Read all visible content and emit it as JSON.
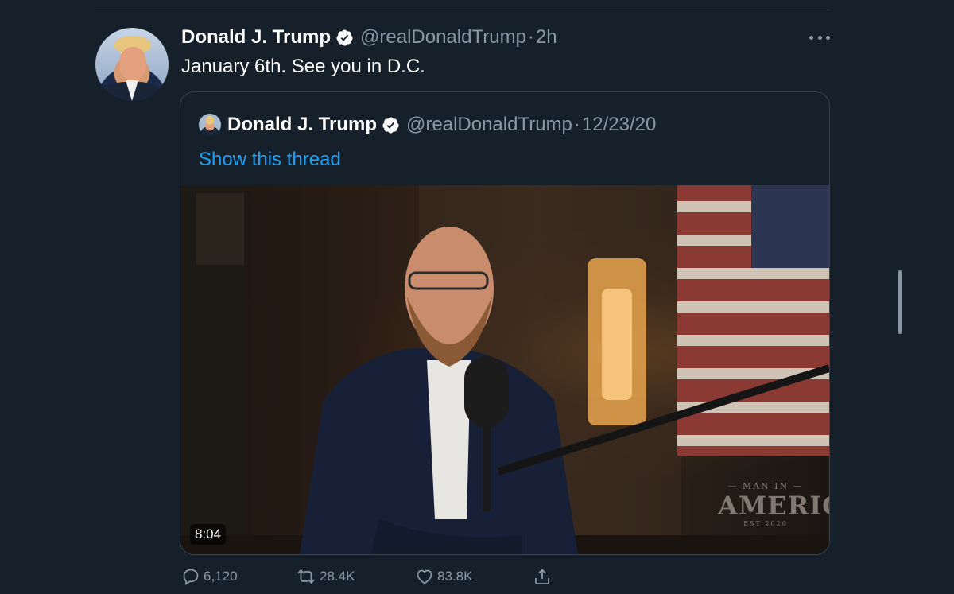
{
  "tweet": {
    "author_name": "Donald J. Trump",
    "handle": "@realDonaldTrump",
    "separator": "·",
    "time": "2h",
    "text": "January 6th. See you in D.C."
  },
  "quoted_tweet": {
    "author_name": "Donald J. Trump",
    "handle": "@realDonaldTrump",
    "separator": "·",
    "date": "12/23/20",
    "show_thread_label": "Show this thread",
    "video": {
      "duration": "8:04",
      "watermark_top": "— MAN IN —",
      "watermark_main": "AMERICA",
      "watermark_bottom": "EST 2020"
    }
  },
  "actions": {
    "reply_count": "6,120",
    "retweet_count": "28.4K",
    "like_count": "83.8K"
  },
  "icons": {
    "verified": "verified-badge-icon",
    "more": "more-options-icon",
    "reply": "reply-icon",
    "retweet": "retweet-icon",
    "like": "heart-icon",
    "share": "share-icon"
  },
  "colors": {
    "background": "#15202b",
    "border": "#38444d",
    "secondary_text": "#8899a6",
    "link": "#1da1f2"
  }
}
